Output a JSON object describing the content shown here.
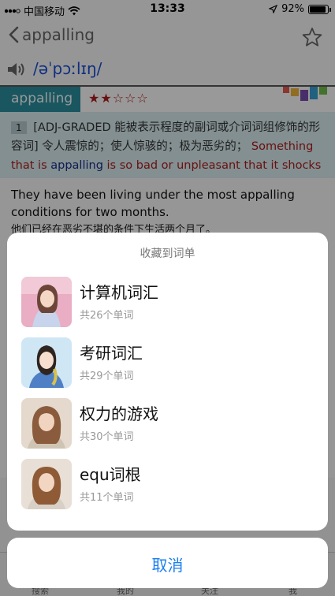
{
  "status_bar": {
    "carrier": "中国移动",
    "time": "13:33",
    "battery": "92%",
    "battery_level": 0.92
  },
  "nav": {
    "back_label": "appalling",
    "icons": [
      "chevron-left-icon",
      "star-outline-icon"
    ]
  },
  "word": {
    "phonetic": "/əˈpɔːlɪŋ/",
    "headword": "appalling",
    "stars": "★★☆☆☆",
    "star_rating": 2
  },
  "definition": {
    "number": "1",
    "grammar": "[ADJ-GRADED 能被表示程度的副词或介词词组修饰的形容词]",
    "chinese": "令人震惊的；使人惊骇的；极为恶劣的；",
    "en_part1": "Something that is",
    "en_highlight": "appalling",
    "en_part2": "is so bad or unpleasant that it shocks you."
  },
  "example": {
    "en": "They have been living under the most appalling conditions for two months.",
    "zh": "他们已经在恶劣不堪的条件下生活两个月了。"
  },
  "tabbar": {
    "tabs": [
      "搜索",
      "我的",
      "关注",
      "我"
    ]
  },
  "sheet": {
    "title": "收藏到词单",
    "items": [
      {
        "name": "计算机词汇",
        "count": "共26个单词"
      },
      {
        "name": "考研词汇",
        "count": "共29个单词"
      },
      {
        "name": "权力的游戏",
        "count": "共30个单词"
      },
      {
        "name": "equ词根",
        "count": "共11个单词"
      }
    ],
    "cancel_label": "取消"
  },
  "colors": {
    "accent_blue": "#1a7ff0",
    "tab_teal": "#2a8fa0",
    "star_red": "#b01d1d"
  }
}
